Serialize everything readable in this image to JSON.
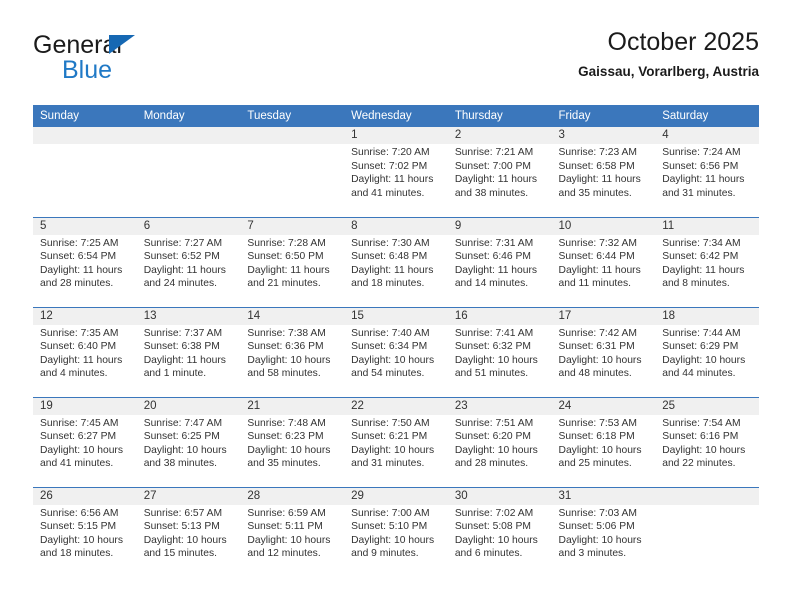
{
  "brand": {
    "line1": "General",
    "line2": "Blue",
    "triangle_color": "#1668b3",
    "blue_text_color": "#2079c6"
  },
  "header": {
    "title": "October 2025",
    "location": "Gaissau, Vorarlberg, Austria"
  },
  "theme": {
    "header_row_bg": "#3b77bc",
    "header_row_text": "#ffffff",
    "daynum_band_bg": "#f0f0f0",
    "cell_bg": "#ffffff",
    "divider": "#3b77bc"
  },
  "weekday_headers": [
    "Sunday",
    "Monday",
    "Tuesday",
    "Wednesday",
    "Thursday",
    "Friday",
    "Saturday"
  ],
  "labels": {
    "sunrise_prefix": "Sunrise: ",
    "sunset_prefix": "Sunset: ",
    "daylight_prefix": "Daylight: "
  },
  "weeks": [
    [
      {
        "day": "",
        "sunrise": "",
        "sunset": "",
        "daylight": ""
      },
      {
        "day": "",
        "sunrise": "",
        "sunset": "",
        "daylight": ""
      },
      {
        "day": "",
        "sunrise": "",
        "sunset": "",
        "daylight": ""
      },
      {
        "day": "1",
        "sunrise": "Sunrise: 7:20 AM",
        "sunset": "Sunset: 7:02 PM",
        "daylight": "Daylight: 11 hours and 41 minutes."
      },
      {
        "day": "2",
        "sunrise": "Sunrise: 7:21 AM",
        "sunset": "Sunset: 7:00 PM",
        "daylight": "Daylight: 11 hours and 38 minutes."
      },
      {
        "day": "3",
        "sunrise": "Sunrise: 7:23 AM",
        "sunset": "Sunset: 6:58 PM",
        "daylight": "Daylight: 11 hours and 35 minutes."
      },
      {
        "day": "4",
        "sunrise": "Sunrise: 7:24 AM",
        "sunset": "Sunset: 6:56 PM",
        "daylight": "Daylight: 11 hours and 31 minutes."
      }
    ],
    [
      {
        "day": "5",
        "sunrise": "Sunrise: 7:25 AM",
        "sunset": "Sunset: 6:54 PM",
        "daylight": "Daylight: 11 hours and 28 minutes."
      },
      {
        "day": "6",
        "sunrise": "Sunrise: 7:27 AM",
        "sunset": "Sunset: 6:52 PM",
        "daylight": "Daylight: 11 hours and 24 minutes."
      },
      {
        "day": "7",
        "sunrise": "Sunrise: 7:28 AM",
        "sunset": "Sunset: 6:50 PM",
        "daylight": "Daylight: 11 hours and 21 minutes."
      },
      {
        "day": "8",
        "sunrise": "Sunrise: 7:30 AM",
        "sunset": "Sunset: 6:48 PM",
        "daylight": "Daylight: 11 hours and 18 minutes."
      },
      {
        "day": "9",
        "sunrise": "Sunrise: 7:31 AM",
        "sunset": "Sunset: 6:46 PM",
        "daylight": "Daylight: 11 hours and 14 minutes."
      },
      {
        "day": "10",
        "sunrise": "Sunrise: 7:32 AM",
        "sunset": "Sunset: 6:44 PM",
        "daylight": "Daylight: 11 hours and 11 minutes."
      },
      {
        "day": "11",
        "sunrise": "Sunrise: 7:34 AM",
        "sunset": "Sunset: 6:42 PM",
        "daylight": "Daylight: 11 hours and 8 minutes."
      }
    ],
    [
      {
        "day": "12",
        "sunrise": "Sunrise: 7:35 AM",
        "sunset": "Sunset: 6:40 PM",
        "daylight": "Daylight: 11 hours and 4 minutes."
      },
      {
        "day": "13",
        "sunrise": "Sunrise: 7:37 AM",
        "sunset": "Sunset: 6:38 PM",
        "daylight": "Daylight: 11 hours and 1 minute."
      },
      {
        "day": "14",
        "sunrise": "Sunrise: 7:38 AM",
        "sunset": "Sunset: 6:36 PM",
        "daylight": "Daylight: 10 hours and 58 minutes."
      },
      {
        "day": "15",
        "sunrise": "Sunrise: 7:40 AM",
        "sunset": "Sunset: 6:34 PM",
        "daylight": "Daylight: 10 hours and 54 minutes."
      },
      {
        "day": "16",
        "sunrise": "Sunrise: 7:41 AM",
        "sunset": "Sunset: 6:32 PM",
        "daylight": "Daylight: 10 hours and 51 minutes."
      },
      {
        "day": "17",
        "sunrise": "Sunrise: 7:42 AM",
        "sunset": "Sunset: 6:31 PM",
        "daylight": "Daylight: 10 hours and 48 minutes."
      },
      {
        "day": "18",
        "sunrise": "Sunrise: 7:44 AM",
        "sunset": "Sunset: 6:29 PM",
        "daylight": "Daylight: 10 hours and 44 minutes."
      }
    ],
    [
      {
        "day": "19",
        "sunrise": "Sunrise: 7:45 AM",
        "sunset": "Sunset: 6:27 PM",
        "daylight": "Daylight: 10 hours and 41 minutes."
      },
      {
        "day": "20",
        "sunrise": "Sunrise: 7:47 AM",
        "sunset": "Sunset: 6:25 PM",
        "daylight": "Daylight: 10 hours and 38 minutes."
      },
      {
        "day": "21",
        "sunrise": "Sunrise: 7:48 AM",
        "sunset": "Sunset: 6:23 PM",
        "daylight": "Daylight: 10 hours and 35 minutes."
      },
      {
        "day": "22",
        "sunrise": "Sunrise: 7:50 AM",
        "sunset": "Sunset: 6:21 PM",
        "daylight": "Daylight: 10 hours and 31 minutes."
      },
      {
        "day": "23",
        "sunrise": "Sunrise: 7:51 AM",
        "sunset": "Sunset: 6:20 PM",
        "daylight": "Daylight: 10 hours and 28 minutes."
      },
      {
        "day": "24",
        "sunrise": "Sunrise: 7:53 AM",
        "sunset": "Sunset: 6:18 PM",
        "daylight": "Daylight: 10 hours and 25 minutes."
      },
      {
        "day": "25",
        "sunrise": "Sunrise: 7:54 AM",
        "sunset": "Sunset: 6:16 PM",
        "daylight": "Daylight: 10 hours and 22 minutes."
      }
    ],
    [
      {
        "day": "26",
        "sunrise": "Sunrise: 6:56 AM",
        "sunset": "Sunset: 5:15 PM",
        "daylight": "Daylight: 10 hours and 18 minutes."
      },
      {
        "day": "27",
        "sunrise": "Sunrise: 6:57 AM",
        "sunset": "Sunset: 5:13 PM",
        "daylight": "Daylight: 10 hours and 15 minutes."
      },
      {
        "day": "28",
        "sunrise": "Sunrise: 6:59 AM",
        "sunset": "Sunset: 5:11 PM",
        "daylight": "Daylight: 10 hours and 12 minutes."
      },
      {
        "day": "29",
        "sunrise": "Sunrise: 7:00 AM",
        "sunset": "Sunset: 5:10 PM",
        "daylight": "Daylight: 10 hours and 9 minutes."
      },
      {
        "day": "30",
        "sunrise": "Sunrise: 7:02 AM",
        "sunset": "Sunset: 5:08 PM",
        "daylight": "Daylight: 10 hours and 6 minutes."
      },
      {
        "day": "31",
        "sunrise": "Sunrise: 7:03 AM",
        "sunset": "Sunset: 5:06 PM",
        "daylight": "Daylight: 10 hours and 3 minutes."
      },
      {
        "day": "",
        "sunrise": "",
        "sunset": "",
        "daylight": ""
      }
    ]
  ]
}
